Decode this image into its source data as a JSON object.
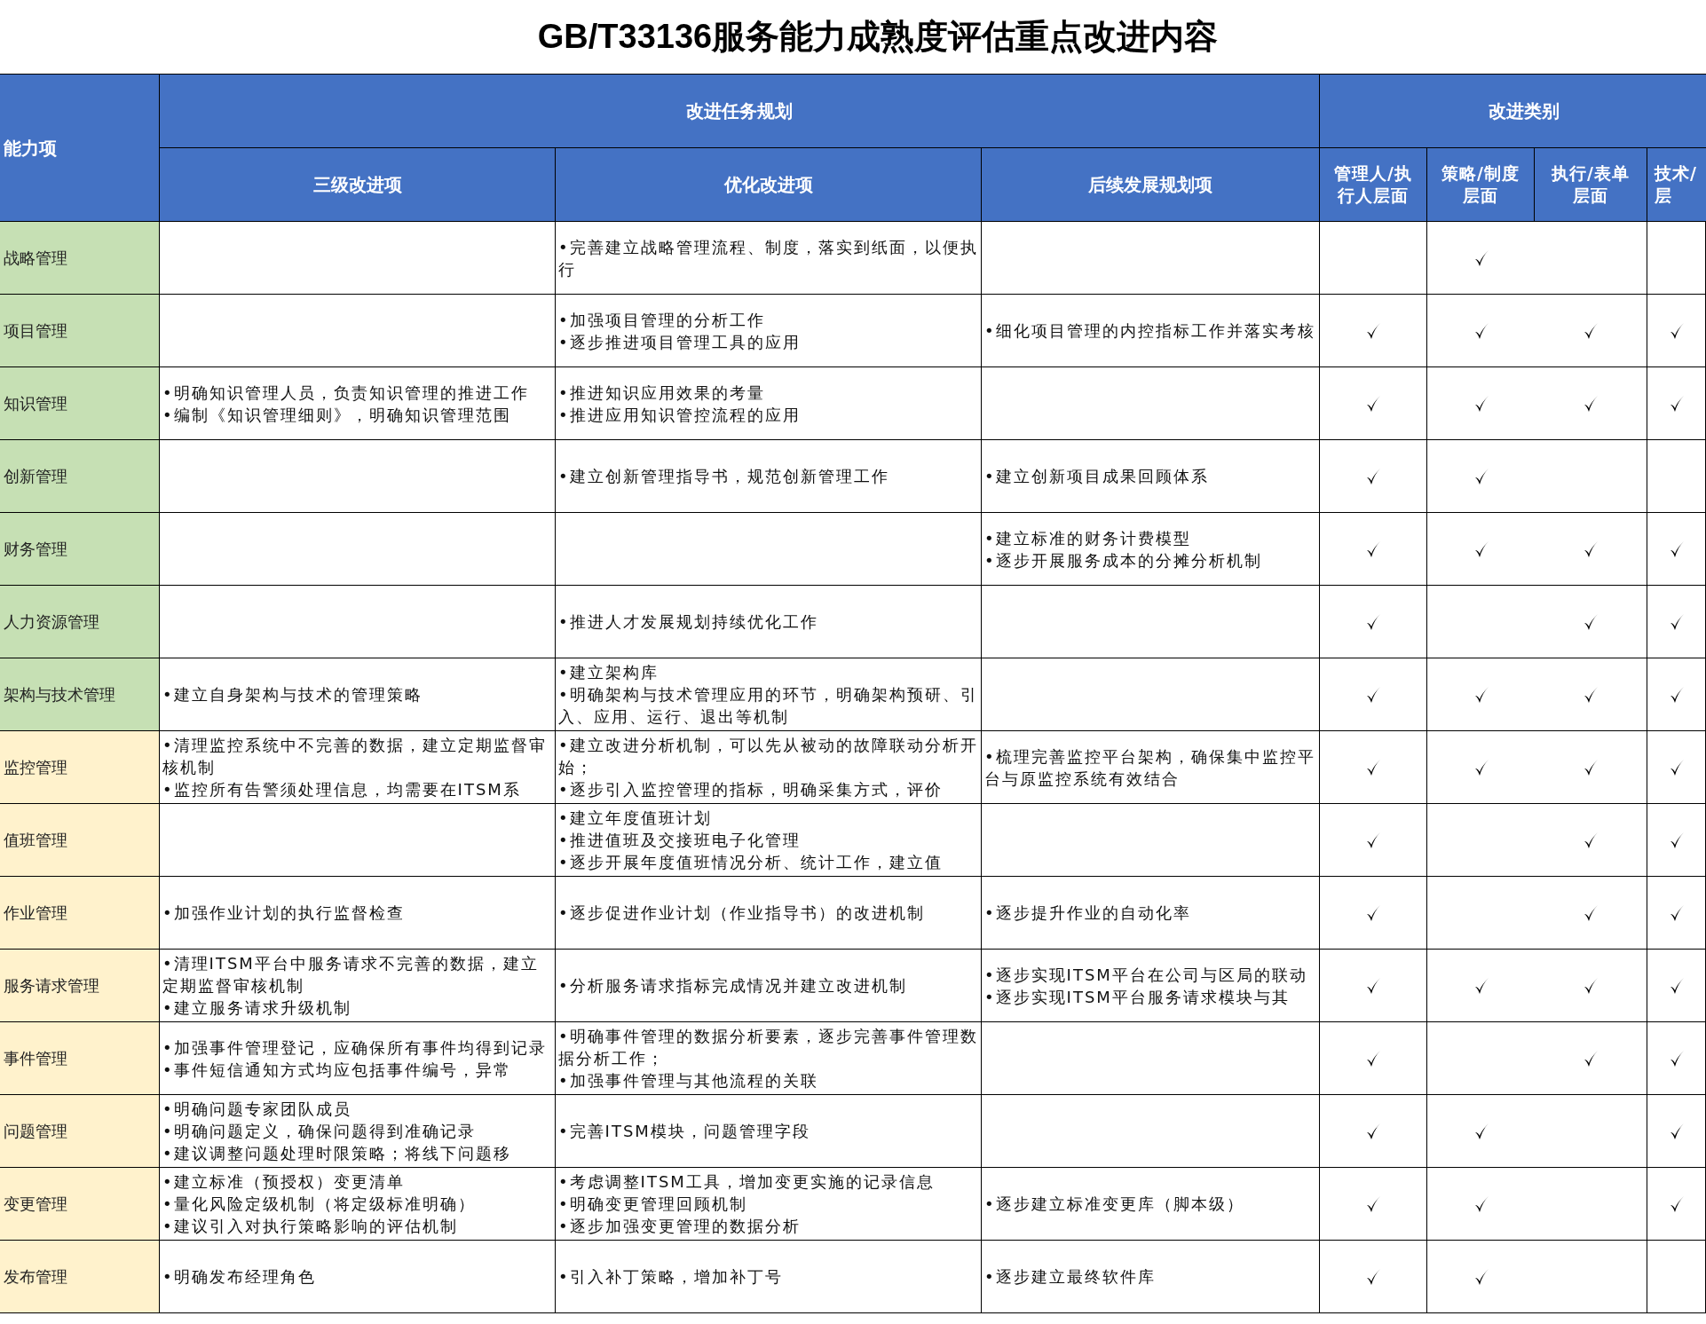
{
  "title": "GB/T33136服务能力成熟度评估重点改进内容",
  "header": {
    "capability": "能力项",
    "group_plan": "改进任务规划",
    "group_category": "改进类别",
    "plan_columns": [
      "三级改进项",
      "优化改进项",
      "后续发展规划项"
    ],
    "category_columns": [
      [
        "管理人/执",
        "行人层面"
      ],
      [
        "策略/制度",
        "层面"
      ],
      [
        "执行/表单",
        "层面"
      ],
      [
        "技术/",
        "层"
      ]
    ]
  },
  "rows": [
    {
      "capability": "战略管理",
      "color": "#c6e0b4",
      "level3": [],
      "optimize": [
        "•完善建立战略管理流程、制度，落实到纸面，以便执行"
      ],
      "future": [],
      "categories": [
        {
          "checked": false
        },
        {
          "checked": true
        },
        {
          "checked": false
        },
        {
          "checked": false
        }
      ]
    },
    {
      "capability": "项目管理",
      "color": "#c6e0b4",
      "level3": [],
      "optimize": [
        "•加强项目管理的分析工作",
        "•逐步推进项目管理工具的应用"
      ],
      "future": [
        "•细化项目管理的内控指标工作并落实考核"
      ],
      "categories": [
        {
          "checked": true
        },
        {
          "checked": true
        },
        {
          "checked": true
        },
        {
          "checked": true
        }
      ]
    },
    {
      "capability": "知识管理",
      "color": "#c6e0b4",
      "level3": [
        "•明确知识管理人员，负责知识管理的推进工作",
        "•编制《知识管理细则》，明确知识管理范围"
      ],
      "optimize": [
        "•推进知识应用效果的考量",
        "•推进应用知识管控流程的应用"
      ],
      "future": [],
      "categories": [
        {
          "checked": true
        },
        {
          "checked": true
        },
        {
          "checked": true
        },
        {
          "checked": true
        }
      ]
    },
    {
      "capability": "创新管理",
      "color": "#c6e0b4",
      "level3": [],
      "optimize": [
        "•建立创新管理指导书，规范创新管理工作"
      ],
      "future": [
        "•建立创新项目成果回顾体系"
      ],
      "categories": [
        {
          "checked": true
        },
        {
          "checked": true
        },
        {
          "checked": false
        },
        {
          "checked": false
        }
      ]
    },
    {
      "capability": "财务管理",
      "color": "#c6e0b4",
      "level3": [],
      "optimize": [],
      "future": [
        "•建立标准的财务计费模型",
        "•逐步开展服务成本的分摊分析机制"
      ],
      "categories": [
        {
          "checked": true
        },
        {
          "checked": true
        },
        {
          "checked": true
        },
        {
          "checked": true
        }
      ]
    },
    {
      "capability": "人力资源管理",
      "color": "#c6e0b4",
      "level3": [],
      "optimize": [
        "•推进人才发展规划持续优化工作"
      ],
      "future": [],
      "categories": [
        {
          "checked": true
        },
        {
          "checked": false
        },
        {
          "checked": true
        },
        {
          "checked": true
        }
      ]
    },
    {
      "capability": "架构与技术管理",
      "color": "#c6e0b4",
      "level3": [
        "•建立自身架构与技术的管理策略"
      ],
      "optimize": [
        "•建立架构库",
        "•明确架构与技术管理应用的环节，明确架构预研、引入、应用、运行、退出等机制"
      ],
      "future": [],
      "categories": [
        {
          "checked": true
        },
        {
          "checked": true
        },
        {
          "checked": true
        },
        {
          "checked": true
        }
      ]
    },
    {
      "capability": "监控管理",
      "color": "#fff2cc",
      "level3": [
        "•清理监控系统中不完善的数据，建立定期监督审核机制",
        "•监控所有告警须处理信息，均需要在ITSM系"
      ],
      "optimize": [
        "•建立改进分析机制，可以先从被动的故障联动分析开始；",
        "•逐步引入监控管理的指标，明确采集方式，评价"
      ],
      "future": [
        "•梳理完善监控平台架构，确保集中监控平台与原监控系统有效结合"
      ],
      "categories": [
        {
          "checked": true
        },
        {
          "checked": true
        },
        {
          "checked": true
        },
        {
          "checked": true
        }
      ]
    },
    {
      "capability": "值班管理",
      "color": "#fff2cc",
      "level3": [],
      "optimize": [
        "•建立年度值班计划",
        "•推进值班及交接班电子化管理",
        "•逐步开展年度值班情况分析、统计工作，建立值"
      ],
      "future": [],
      "categories": [
        {
          "checked": true
        },
        {
          "checked": false
        },
        {
          "checked": true
        },
        {
          "checked": true
        }
      ]
    },
    {
      "capability": "作业管理",
      "color": "#fff2cc",
      "level3": [
        "•加强作业计划的执行监督检查"
      ],
      "optimize": [
        "•逐步促进作业计划（作业指导书）的改进机制"
      ],
      "future": [
        "•逐步提升作业的自动化率"
      ],
      "categories": [
        {
          "checked": true
        },
        {
          "checked": false
        },
        {
          "checked": true
        },
        {
          "checked": true
        }
      ]
    },
    {
      "capability": "服务请求管理",
      "color": "#fff2cc",
      "level3": [
        "•清理ITSM平台中服务请求不完善的数据，建立定期监督审核机制",
        "•建立服务请求升级机制"
      ],
      "optimize": [
        "•分析服务请求指标完成情况并建立改进机制"
      ],
      "future": [
        "•逐步实现ITSM平台在公司与区局的联动",
        "•逐步实现ITSM平台服务请求模块与其"
      ],
      "categories": [
        {
          "checked": true
        },
        {
          "checked": true
        },
        {
          "checked": true
        },
        {
          "checked": true
        }
      ]
    },
    {
      "capability": "事件管理",
      "color": "#fff2cc",
      "level3": [
        "•加强事件管理登记，应确保所有事件均得到记录",
        "•事件短信通知方式均应包括事件编号，异常"
      ],
      "optimize": [
        "•明确事件管理的数据分析要素，逐步完善事件管理数据分析工作；",
        "•加强事件管理与其他流程的关联"
      ],
      "future": [],
      "categories": [
        {
          "checked": true
        },
        {
          "checked": false
        },
        {
          "checked": true
        },
        {
          "checked": true
        }
      ]
    },
    {
      "capability": "问题管理",
      "color": "#fff2cc",
      "level3": [
        "•明确问题专家团队成员",
        "•明确问题定义，确保问题得到准确记录",
        "•建议调整问题处理时限策略；将线下问题移"
      ],
      "optimize": [
        "•完善ITSM模块，问题管理字段"
      ],
      "future": [],
      "categories": [
        {
          "checked": true
        },
        {
          "checked": true
        },
        {
          "checked": false
        },
        {
          "checked": true
        }
      ]
    },
    {
      "capability": "变更管理",
      "color": "#fff2cc",
      "level3": [
        "•建立标准（预授权）变更清单",
        "•量化风险定级机制（将定级标准明确）",
        "•建议引入对执行策略影响的评估机制"
      ],
      "optimize": [
        "•考虑调整ITSM工具，增加变更实施的记录信息",
        "•明确变更管理回顾机制",
        "•逐步加强变更管理的数据分析"
      ],
      "future": [
        "•逐步建立标准变更库（脚本级）"
      ],
      "categories": [
        {
          "checked": true
        },
        {
          "checked": true
        },
        {
          "checked": false
        },
        {
          "checked": true
        }
      ]
    },
    {
      "capability": "发布管理",
      "color": "#fff2cc",
      "level3": [
        "•明确发布经理角色"
      ],
      "optimize": [
        "•引入补丁策略，增加补丁号"
      ],
      "future": [
        "•逐步建立最终软件库"
      ],
      "categories": [
        {
          "checked": true
        },
        {
          "checked": true
        },
        {
          "checked": false
        },
        {
          "checked": false
        }
      ]
    }
  ]
}
